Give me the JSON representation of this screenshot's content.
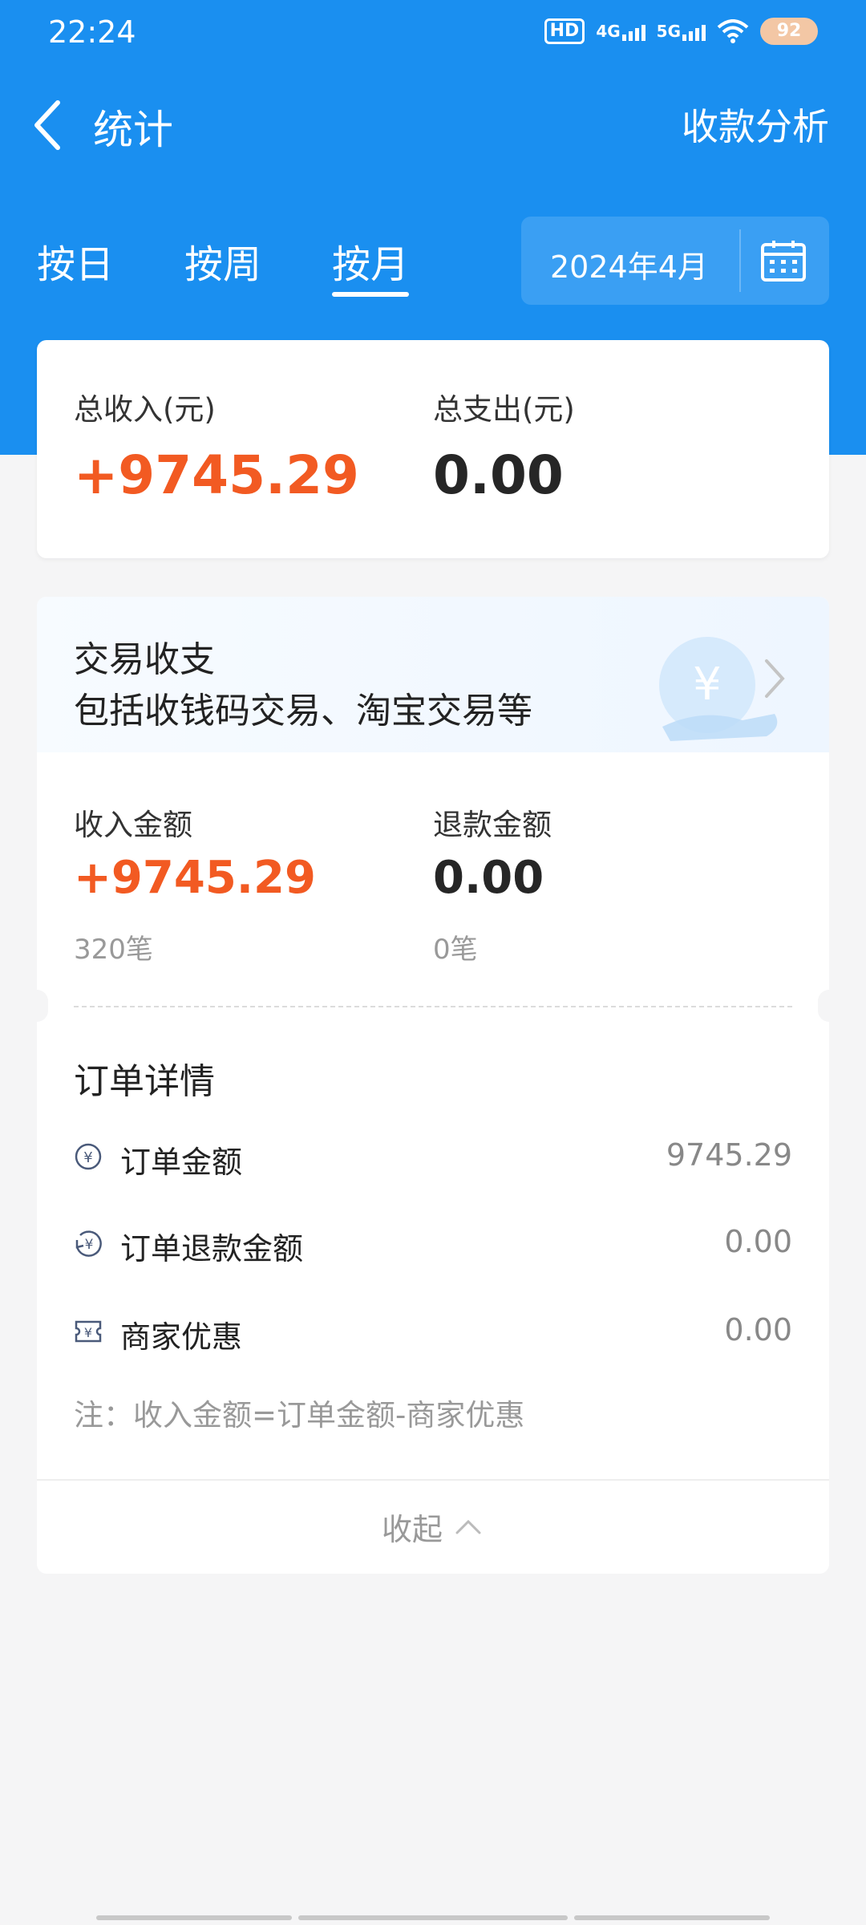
{
  "status_bar": {
    "time": "22:24",
    "hd": "HD",
    "net1": "4G",
    "net2": "5G",
    "battery": "92"
  },
  "nav": {
    "title": "统计",
    "action": "收款分析"
  },
  "tabs": {
    "day": "按日",
    "week": "按周",
    "month": "按月",
    "selected": "按月"
  },
  "date_picker": {
    "value": "2024年4月"
  },
  "totals": {
    "income_label": "总收入(元)",
    "income_value": "+9745.29",
    "expense_label": "总支出(元)",
    "expense_value": "0.00"
  },
  "transactions": {
    "title": "交易收支",
    "subtitle": "包括收钱码交易、淘宝交易等",
    "income_label": "收入金额",
    "income_value": "+9745.29",
    "income_count": "320笔",
    "refund_label": "退款金额",
    "refund_value": "0.00",
    "refund_count": "0笔"
  },
  "order_details": {
    "title": "订单详情",
    "rows": [
      {
        "label": "订单金额",
        "value": "9745.29",
        "icon": "yen-circle-icon"
      },
      {
        "label": "订单退款金额",
        "value": "0.00",
        "icon": "yen-refund-icon"
      },
      {
        "label": "商家优惠",
        "value": "0.00",
        "icon": "yen-coupon-icon"
      }
    ],
    "note": "注：收入金额=订单金额-商家优惠"
  },
  "collapse_label": "收起",
  "colors": {
    "header_blue": "#1a8ff0",
    "income_orange": "#f25a22"
  }
}
